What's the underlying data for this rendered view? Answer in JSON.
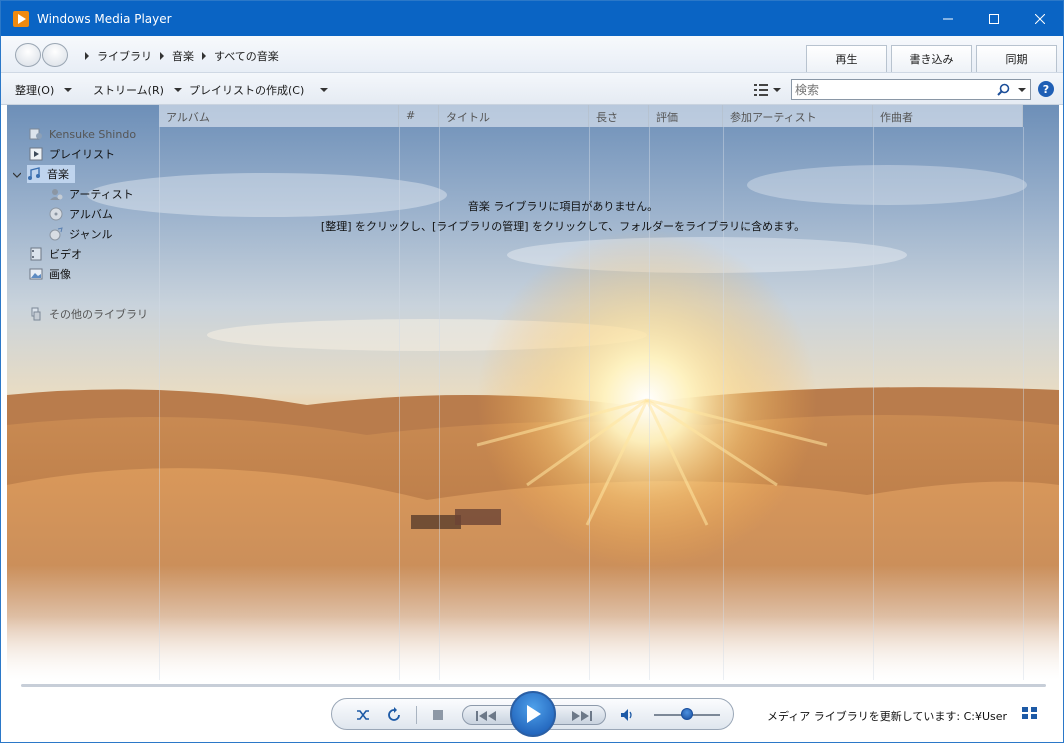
{
  "window": {
    "title": "Windows Media Player"
  },
  "breadcrumb": [
    "ライブラリ",
    "音楽",
    "すべての音楽"
  ],
  "tabs": [
    {
      "label": "再生"
    },
    {
      "label": "書き込み"
    },
    {
      "label": "同期"
    }
  ],
  "toolbar": {
    "organize": "整理(O)",
    "stream": "ストリーム(R)",
    "create_playlist": "プレイリストの作成(C)",
    "search_placeholder": "検索"
  },
  "nav": {
    "user": "Kensuke Shindo",
    "playlist": "プレイリスト",
    "music": "音楽",
    "artist": "アーティスト",
    "album": "アルバム",
    "genre": "ジャンル",
    "video": "ビデオ",
    "pictures": "画像",
    "other_libraries": "その他のライブラリ"
  },
  "columns": [
    "アルバム",
    "#",
    "タイトル",
    "長さ",
    "評価",
    "参加アーティスト",
    "作曲者"
  ],
  "empty_message": {
    "line1": "音楽 ライブラリに項目がありません。",
    "line2": "[整理] をクリックし、[ライブラリの管理] をクリックして、フォルダーをライブラリに含めます。"
  },
  "playback": {
    "volume_fraction": 0.5
  },
  "status": {
    "text": "メディア ライブラリを更新しています: C:¥Users¥ve"
  },
  "colors": {
    "titlebar": "#0a64c4",
    "accent": "#1655b0"
  }
}
